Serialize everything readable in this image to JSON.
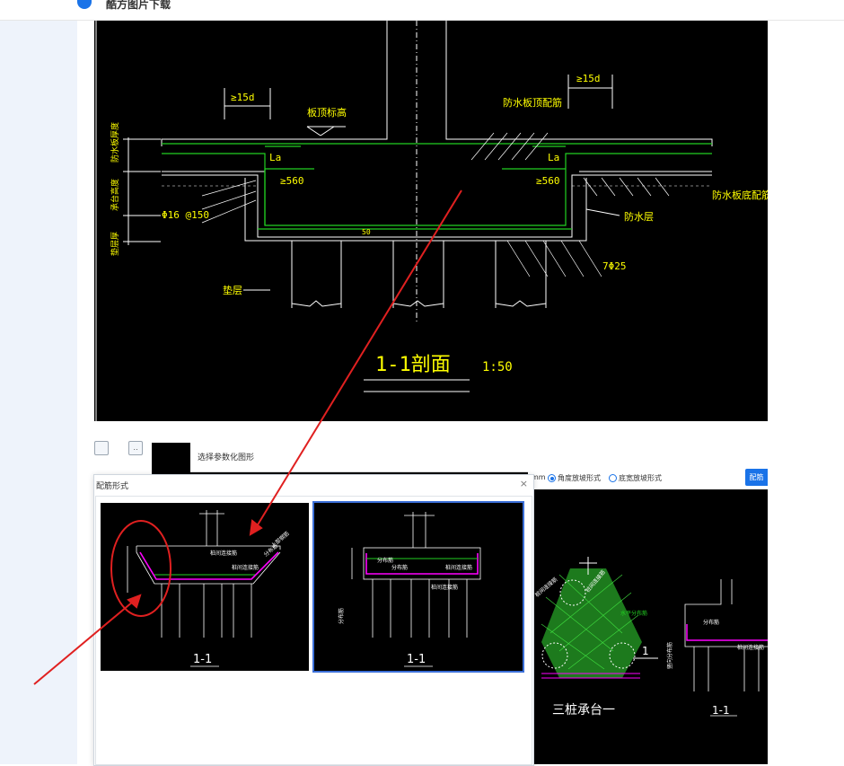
{
  "topbar": {
    "logo_text": "酷方图片下载"
  },
  "cad_main": {
    "labels": {
      "lap_left": "≥15d",
      "lap_right": "≥15d",
      "slab_top": "板顶标高",
      "wp_top_rebar": "防水板顶配筋",
      "la_left": "La",
      "la_right": "La",
      "len_left": "≥560",
      "len_right": "≥560",
      "rebar_spec": "Φ16 @150",
      "wp_bottom_rebar": "防水板底配筋",
      "wp_layer": "防水层",
      "pile_rebar": "7Φ25",
      "cushion": "垫层",
      "dim_50": "50",
      "v1": "防水板厚度",
      "v2": "承台高度",
      "v3": "垫层厚",
      "section": "1-1剖面",
      "scale": "1:50"
    }
  },
  "app": {
    "dialog_title": "选择参数化图形",
    "options": {
      "unit": "mm",
      "opt1": "角度放坡形式",
      "opt2": "底宽放坡形式"
    },
    "button": "配筋"
  },
  "rebar_dialog": {
    "title": "配筋形式",
    "close": "×",
    "thumb1": {
      "lbl_a": "桩间连接筋",
      "lbl_b": "桩间连接筋",
      "lbl_c": "分布筋",
      "lbl_d": "上部钢筋",
      "section": "1-1"
    },
    "thumb2": {
      "lbl_a": "分布筋",
      "lbl_b": "分布筋",
      "lbl_c": "桩间连接筋",
      "lbl_d": "桩间连接筋",
      "lbl_e": "分布筋",
      "section": "1-1"
    }
  },
  "cad_right": {
    "lbl1": "桩间连接筋",
    "lbl2": "桩间连接筋",
    "lbl3": "竖向分布筋",
    "lbl4": "水平分布筋",
    "lbl5": "三桩承台一",
    "lbl6": "1-1",
    "lbl7": "1",
    "lbl8": "分布筋",
    "lbl9": "桩间连接筋"
  }
}
